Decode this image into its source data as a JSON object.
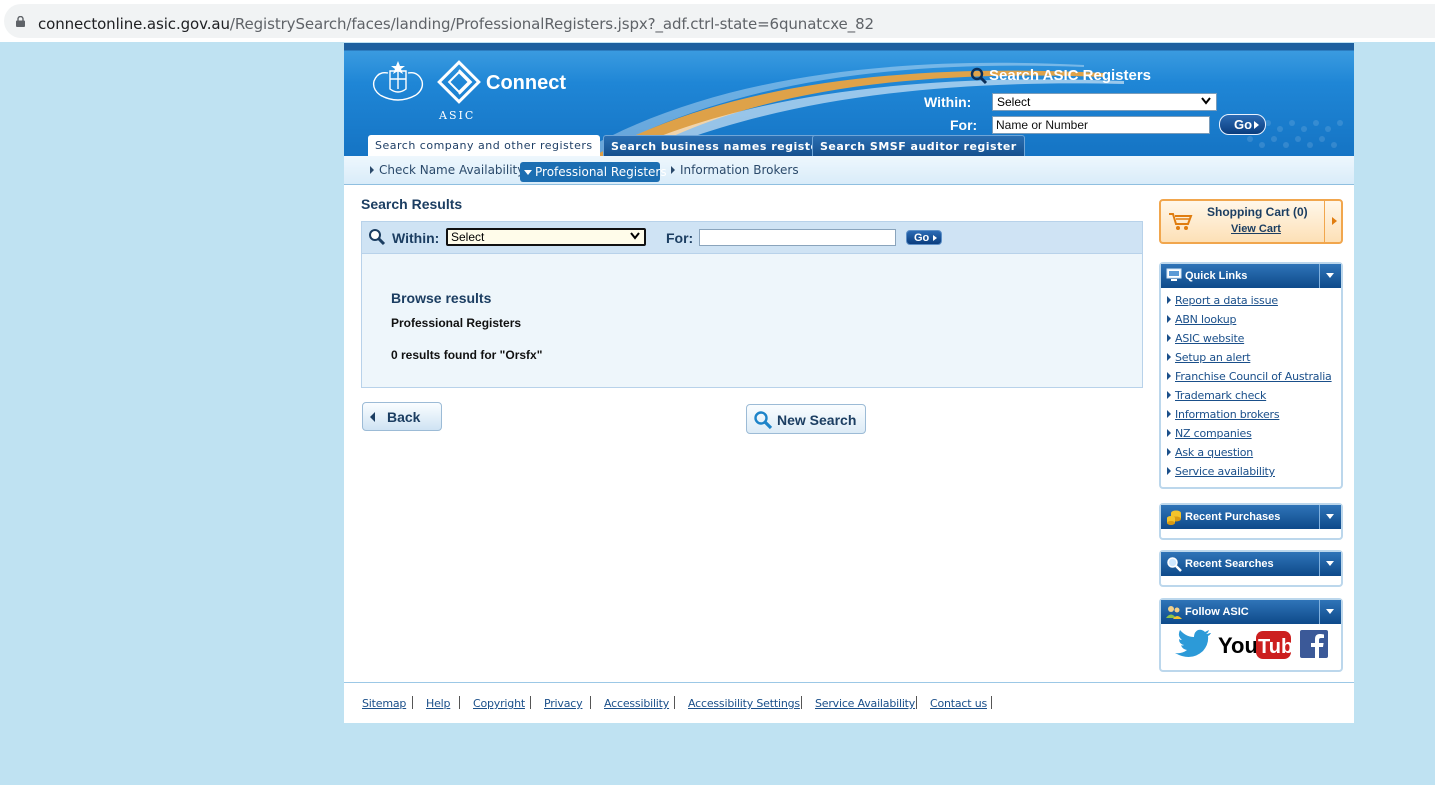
{
  "browser": {
    "url_host": "connectonline.asic.gov.au",
    "url_path": "/RegistrySearch/faces/landing/ProfessionalRegisters.jspx?_adf.ctrl-state=6qunatcxe_82"
  },
  "header": {
    "brand": "Connect",
    "org": "ASIC",
    "search_title": "Search ASIC Registers",
    "within_label": "Within:",
    "for_label": "For:",
    "within_value": "Select",
    "for_value": "Name or Number",
    "go_label": "Go"
  },
  "tabs": [
    {
      "label": "Search company and other registers",
      "active": true
    },
    {
      "label": "Search business names register",
      "active": false
    },
    {
      "label": "Search SMSF auditor register",
      "active": false
    }
  ],
  "subnav": [
    {
      "label": "Check Name Availability",
      "active": false
    },
    {
      "label": "Professional Registers",
      "active": true
    },
    {
      "label": "Information Brokers",
      "active": false
    }
  ],
  "main": {
    "title": "Search Results",
    "within_label": "Within:",
    "within_value": "Select",
    "for_label": "For:",
    "for_value": "",
    "go_label": "Go",
    "browse_title": "Browse results",
    "register_name": "Professional Registers",
    "results_text": "0 results found for \"Orsfx\"",
    "back_label": "Back",
    "new_search_label": "New Search"
  },
  "sidebar": {
    "cart_title": "Shopping Cart (0)",
    "cart_link": "View Cart",
    "quick_links_title": "Quick Links",
    "quick_links": [
      "Report a data issue",
      "ABN lookup",
      "ASIC website",
      "Setup an alert",
      "Franchise Council of Australia",
      "Trademark check",
      "Information brokers",
      "NZ companies",
      "Ask a question",
      "Service availability"
    ],
    "recent_purchases_title": "Recent Purchases",
    "recent_searches_title": "Recent Searches",
    "follow_title": "Follow ASIC",
    "social": [
      "twitter-icon",
      "youtube-icon",
      "facebook-icon"
    ]
  },
  "footer": {
    "links": [
      "Sitemap",
      "Help",
      "Copyright",
      "Privacy",
      "Accessibility",
      "Accessibility Settings",
      "Service Availability",
      "Contact us"
    ]
  },
  "colors": {
    "page_bg": "#bfe2f2",
    "banner_blue": "#1f86d6",
    "nav_active": "#1c6eb2",
    "text_dark_blue": "#1c3e62",
    "cart_orange": "#f1a64d"
  }
}
